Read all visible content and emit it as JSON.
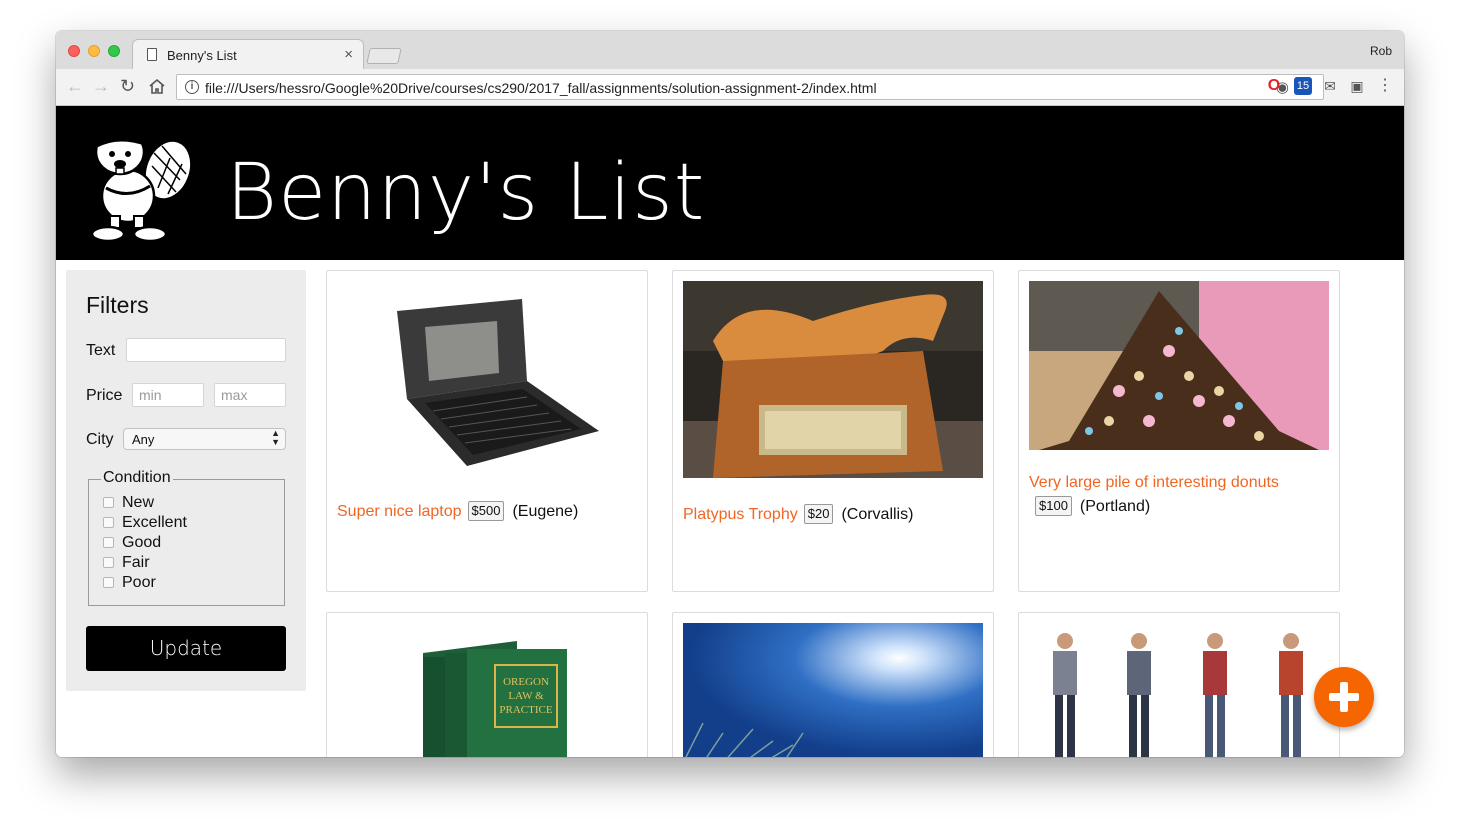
{
  "browser": {
    "tab_title": "Benny's List",
    "tab_close": "×",
    "profile_name": "Rob",
    "url": "file:///Users/hessro/Google%20Drive/courses/cs290/2017_fall/assignments/solution-assignment-2/index.html",
    "extension_badge": "15"
  },
  "site": {
    "title": "Benny's List"
  },
  "filters": {
    "heading": "Filters",
    "text_label": "Text",
    "text_value": "",
    "price_label": "Price",
    "price_min_placeholder": "min",
    "price_max_placeholder": "max",
    "city_label": "City",
    "city_selected": "Any",
    "condition_legend": "Condition",
    "conditions": [
      "New",
      "Excellent",
      "Good",
      "Fair",
      "Poor"
    ],
    "update_label": "Update"
  },
  "posts": [
    {
      "title": "Super nice laptop",
      "price": "$500",
      "city": "(Eugene)"
    },
    {
      "title": "Platypus Trophy",
      "price": "$20",
      "city": "(Corvallis)"
    },
    {
      "title": "Very large pile of interesting donuts",
      "price": "$100",
      "city": "(Portland)"
    },
    {
      "title": "",
      "price": "",
      "city": "",
      "image_text": [
        "OREGON",
        "LAW &",
        "PRACTICE"
      ]
    },
    {
      "title": "",
      "price": "",
      "city": ""
    },
    {
      "title": "",
      "price": "",
      "city": ""
    }
  ],
  "colors": {
    "accent": "#f26522",
    "fab": "#f56600",
    "header_bg": "#000000",
    "filters_bg": "#ececec"
  },
  "icons": {
    "fab": "plus-icon",
    "logo": "beaver-mascot-icon"
  }
}
